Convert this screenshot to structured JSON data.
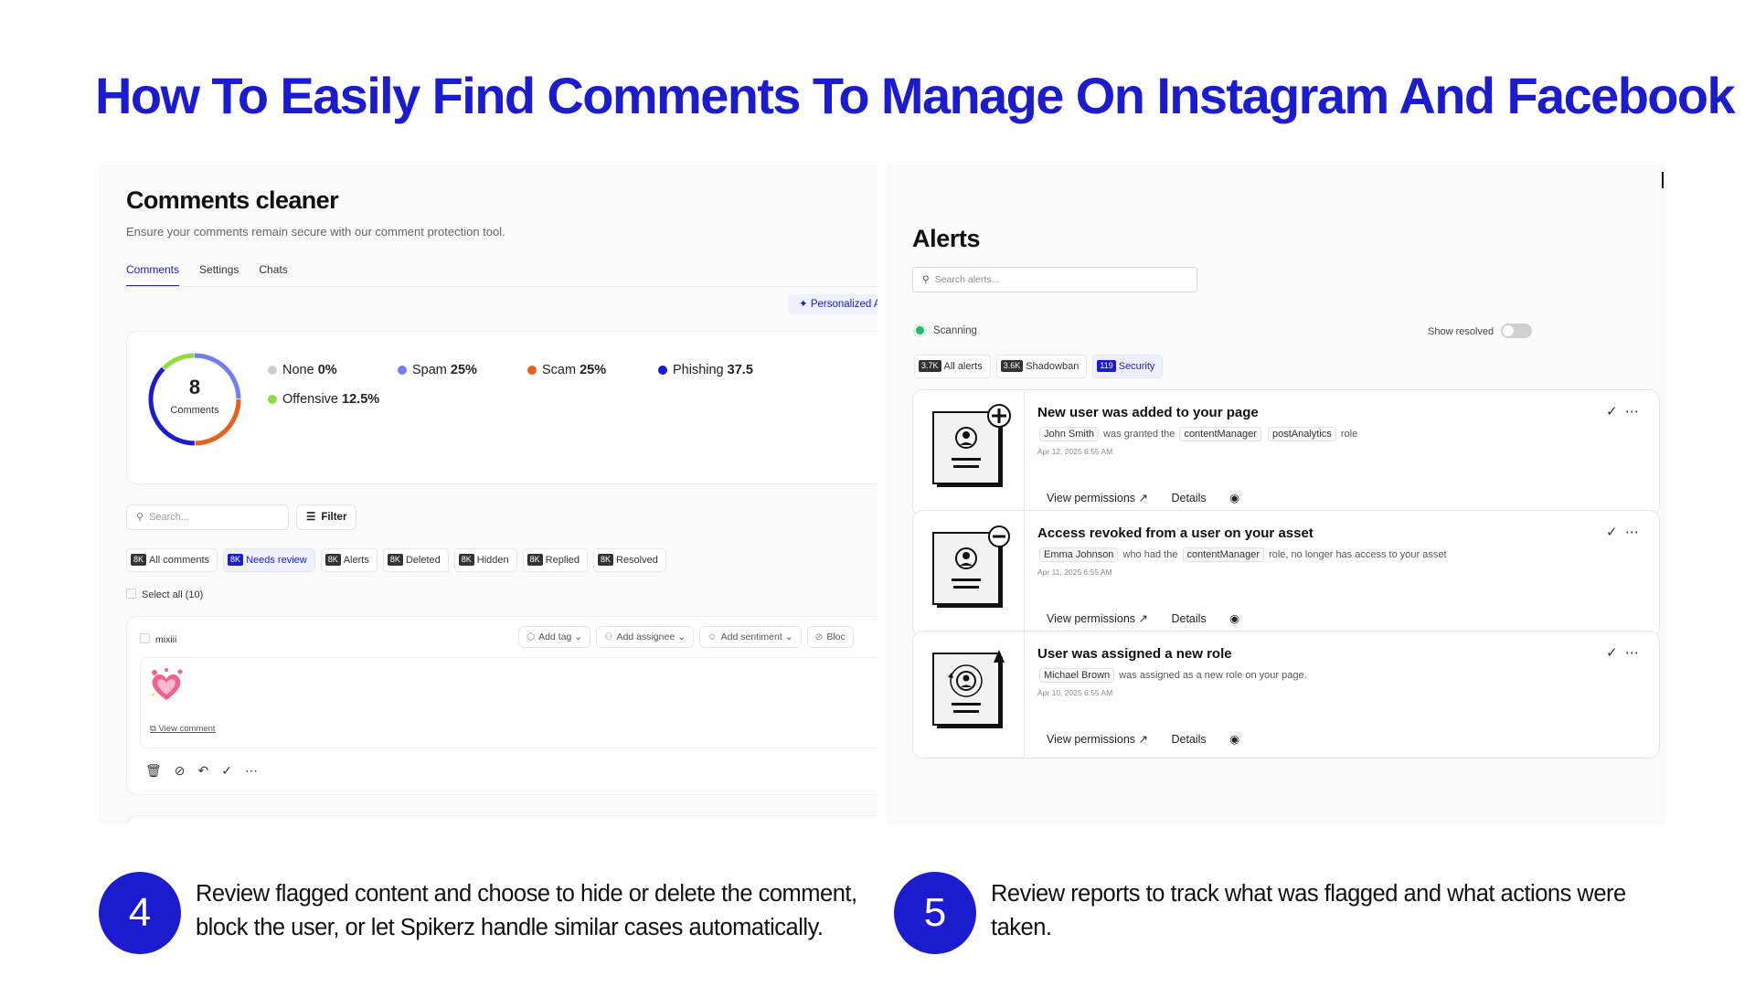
{
  "title": "How To Easily Find Comments To Manage On Instagram And Facebook",
  "brand_color": "#1b1bd0",
  "comments_cleaner": {
    "title": "Comments cleaner",
    "subtitle": "Ensure your comments remain secure with our comment protection tool.",
    "tabs": [
      "Comments",
      "Settings",
      "Chats"
    ],
    "personalized_label": "Personalized A",
    "donut": {
      "count": "8",
      "label": "Comments",
      "segments": [
        {
          "name": "Spam",
          "percent": 25,
          "color": "#6f7ff0"
        },
        {
          "name": "Scam",
          "percent": 25,
          "color": "#e8611a"
        },
        {
          "name": "Phishing",
          "percent": 37.5,
          "color": "#1b1bd0"
        },
        {
          "name": "Offensive",
          "percent": 12.5,
          "color": "#8fdc3c"
        }
      ]
    },
    "legend": [
      {
        "name": "None",
        "value": "0%",
        "color": "#cfcfcf"
      },
      {
        "name": "Spam",
        "value": "25%",
        "color": "#6f7ff0"
      },
      {
        "name": "Scam",
        "value": "25%",
        "color": "#e8611a"
      },
      {
        "name": "Phishing",
        "value": "37.5",
        "color": "#1b1bd0"
      },
      {
        "name": "Offensive",
        "value": "12.5%",
        "color": "#8fdc3c"
      }
    ],
    "search_placeholder": "Search...",
    "filter_label": "Filter",
    "chips": [
      {
        "count": "8K",
        "label": "All comments"
      },
      {
        "count": "8K",
        "label": "Needs review"
      },
      {
        "count": "8K",
        "label": "Alerts"
      },
      {
        "count": "8K",
        "label": "Deleted"
      },
      {
        "count": "8K",
        "label": "Hidden"
      },
      {
        "count": "8K",
        "label": "Replied"
      },
      {
        "count": "8K",
        "label": "Resolved"
      }
    ],
    "select_all": "Select all (10)",
    "comment": {
      "user": "mixiii",
      "actions": [
        "Add tag",
        "Add assignee",
        "Add sentiment",
        "Bloc"
      ],
      "view_comment": "View comment"
    }
  },
  "alerts": {
    "title": "Alerts",
    "search_placeholder": "Search alerts...",
    "scanning": "Scanning",
    "show_resolved": "Show resolved",
    "chips": [
      {
        "count": "3.7K",
        "label": "All alerts"
      },
      {
        "count": "3.6K",
        "label": "Shadowban"
      },
      {
        "count": "119",
        "label": "Security"
      }
    ],
    "items": [
      {
        "title": "New user was added to your page",
        "name": "John Smith",
        "text1": "was granted the",
        "tag1": "contentManager",
        "tag2": "postAnalytics",
        "text2": "role",
        "date": "Apr 12, 2025 6:55 AM",
        "link1": "View permissions ↗",
        "link2": "Details"
      },
      {
        "title": "Access revoked from a user on your asset",
        "name": "Emma Johnson",
        "text1": "who had the",
        "tag1": "contentManager",
        "text2": "role, no longer has access to your asset",
        "date": "Apr 11, 2025 6:55 AM",
        "link1": "View permissions ↗",
        "link2": "Details"
      },
      {
        "title": "User was assigned a new role",
        "name": "Michael Brown",
        "text1": "was assigned as a new role on your page.",
        "date": "Apr 10, 2025 6:55 AM",
        "link1": "View permissions ↗",
        "link2": "Details"
      }
    ]
  },
  "steps": [
    {
      "number": "4",
      "text": "Review flagged content and choose to hide or delete the comment, block the user, or let Spikerz handle similar cases automatically."
    },
    {
      "number": "5",
      "text": "Review reports to track what was flagged and what actions were taken."
    }
  ]
}
